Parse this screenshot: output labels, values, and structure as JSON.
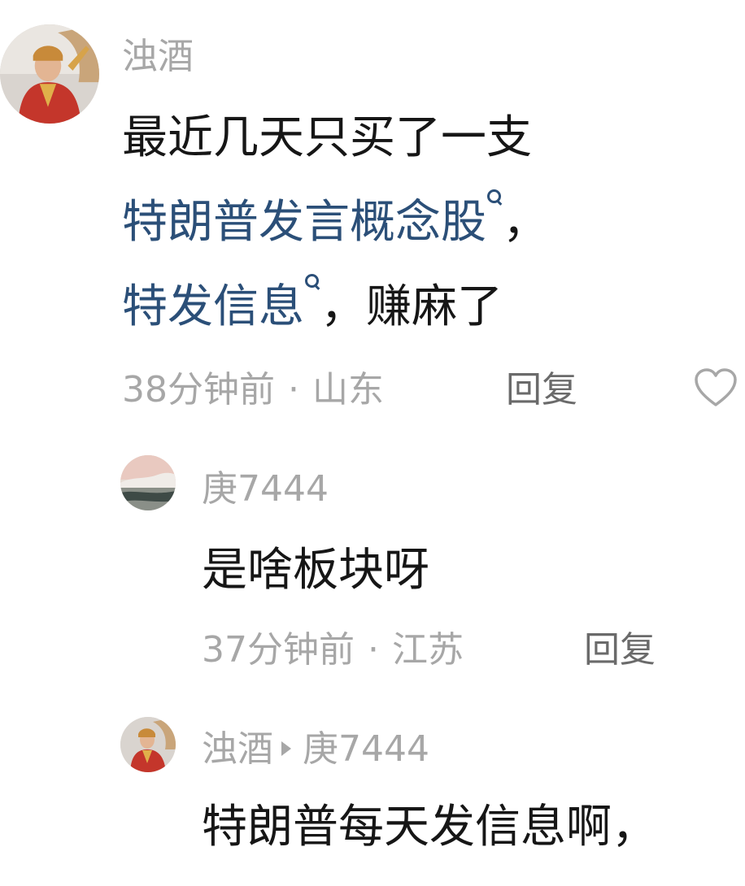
{
  "comments": [
    {
      "username": "浊酒",
      "text_line1": "最近几天只买了一支",
      "link1": "特朗普发言概念股",
      "after_link1": "，",
      "link2": "特发信息",
      "after_link2": "，赚麻了",
      "time": "38分钟前",
      "location": "山东",
      "reply_label": "回复",
      "like_icon": "heart-outline-icon"
    }
  ],
  "replies": [
    {
      "username": "庚7444",
      "text": "是啥板块呀",
      "time": "37分钟前",
      "location": "江苏",
      "reply_label": "回复"
    },
    {
      "username": "浊酒",
      "reply_to": "庚7444",
      "text": "特朗普每天发信息啊，"
    }
  ],
  "meta_separator": "·",
  "colors": {
    "link": "#2b4f78",
    "muted": "#a7a7a7",
    "reply": "#6a6a6a",
    "text": "#161616"
  }
}
